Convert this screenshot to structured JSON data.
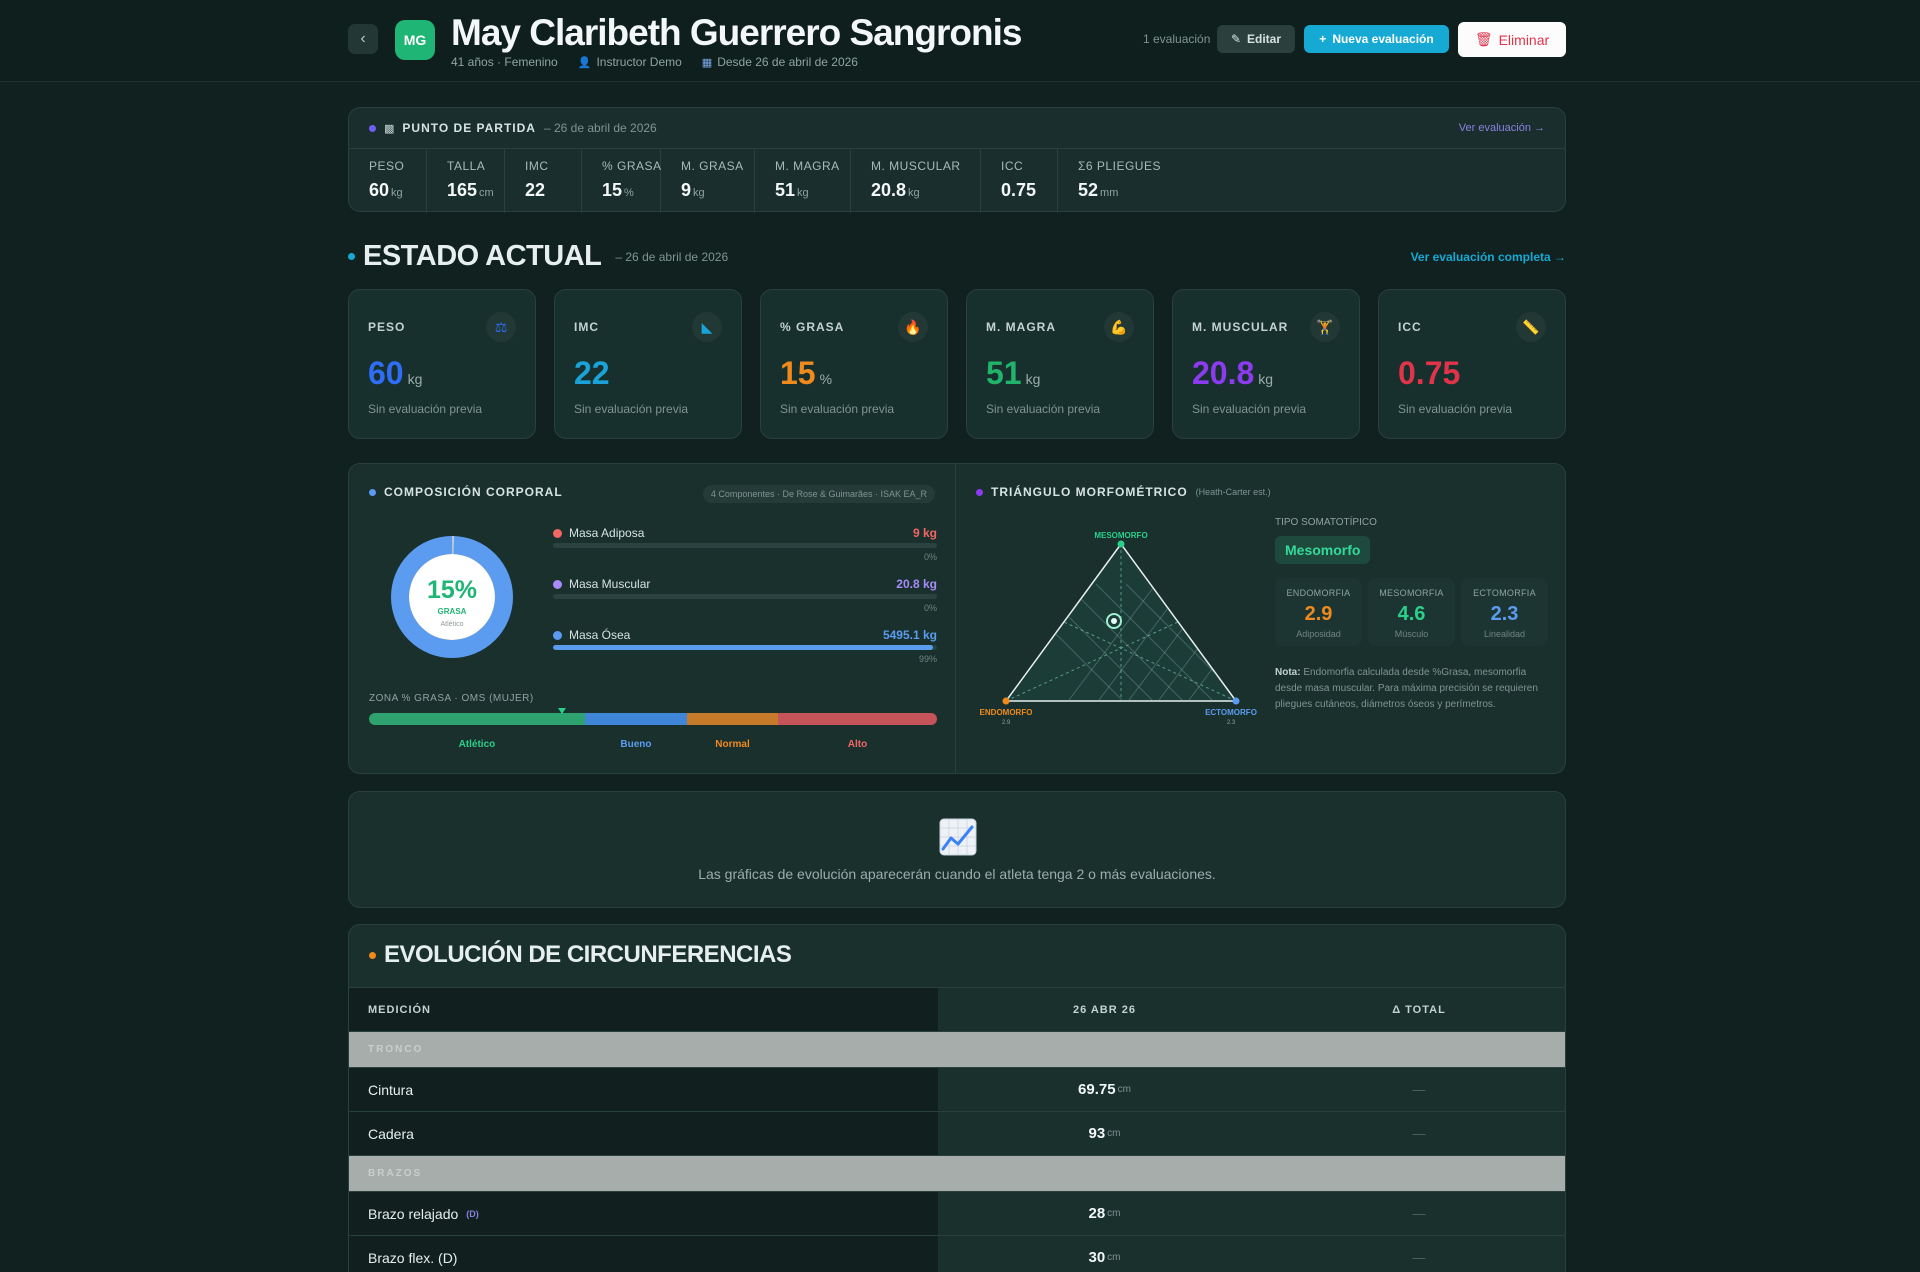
{
  "header": {
    "back_icon": "chevron-left-icon",
    "avatar_initials": "MG",
    "name": "May Claribeth Guerrero Sangronis",
    "meta_age_gender": "41 años · Femenino",
    "meta_instructor": "Instructor Demo",
    "meta_since": "Desde 26 de abril de 2026",
    "eval_count": "1 evaluación",
    "edit_label": "Editar",
    "new_eval_label": "Nueva evaluación",
    "delete_label": "Eliminar",
    "colors": {
      "avatar": "#1fb574",
      "primary": "#16a9d3",
      "danger": "#e0344a"
    }
  },
  "start": {
    "title": "PUNTO DE PARTIDA",
    "date": "– 26 de abril de 2026",
    "link": "Ver evaluación →",
    "metrics": [
      {
        "label": "PESO",
        "value": "60",
        "unit": "kg"
      },
      {
        "label": "TALLA",
        "value": "165",
        "unit": "cm"
      },
      {
        "label": "IMC",
        "value": "22",
        "unit": ""
      },
      {
        "label": "% GRASA",
        "value": "15",
        "unit": "%"
      },
      {
        "label": "M. GRASA",
        "value": "9",
        "unit": "kg"
      },
      {
        "label": "M. MAGRA",
        "value": "51",
        "unit": "kg"
      },
      {
        "label": "M. MUSCULAR",
        "value": "20.8",
        "unit": "kg"
      },
      {
        "label": "ICC",
        "value": "0.75",
        "unit": ""
      },
      {
        "label": "Σ6 PLIEGUES",
        "value": "52",
        "unit": "mm"
      }
    ]
  },
  "current": {
    "title": "ESTADO ACTUAL",
    "date": "– 26 de abril de 2026",
    "link": "Ver evaluación completa →",
    "kpis": [
      {
        "label": "PESO",
        "icon": "scale-icon",
        "glyph": "⚖",
        "value": "60",
        "unit": "kg",
        "sub": "Sin evaluación previa",
        "color": "#2f6df6"
      },
      {
        "label": "IMC",
        "icon": "ruler-triangle-icon",
        "glyph": "◣",
        "value": "22",
        "unit": "",
        "sub": "Sin evaluación previa",
        "color": "#1aa3d8"
      },
      {
        "label": "% GRASA",
        "icon": "flame-icon",
        "glyph": "🔥",
        "value": "15",
        "unit": "%",
        "sub": "Sin evaluación previa",
        "color": "#f08a1c"
      },
      {
        "label": "M. MAGRA",
        "icon": "flexed-arm-icon",
        "glyph": "💪",
        "value": "51",
        "unit": "kg",
        "sub": "Sin evaluación previa",
        "color": "#22b36b"
      },
      {
        "label": "M. MUSCULAR",
        "icon": "weightlifter-icon",
        "glyph": "🏋",
        "value": "20.8",
        "unit": "kg",
        "sub": "Sin evaluación previa",
        "color": "#8c3bf0"
      },
      {
        "label": "ICC",
        "icon": "tape-measure-icon",
        "glyph": "📏",
        "value": "0.75",
        "unit": "",
        "sub": "Sin evaluación previa",
        "color": "#e0344a"
      }
    ]
  },
  "composition": {
    "title": "COMPOSICIÓN CORPORAL",
    "tag": "4 Componentes · De Rose & Guimarães · ISAK EA_R",
    "donut_value": "15%",
    "donut_label": "GRASA",
    "donut_sub": "Atlético",
    "donut_fraction": 0.15,
    "items": [
      {
        "name": "Masa Adiposa",
        "value": "9 kg",
        "pct": "0%",
        "fill": 0.0,
        "color": "#f26666"
      },
      {
        "name": "Masa Muscular",
        "value": "20.8 kg",
        "pct": "0%",
        "fill": 0.0,
        "color": "#a78bfa"
      },
      {
        "name": "Masa Ósea",
        "value": "5495.1 kg",
        "pct": "99%",
        "fill": 0.99,
        "color": "#5b9cf0"
      }
    ],
    "zone_title": "ZONA % GRASA · OMS (MUJER)",
    "zone_marker": 0.34,
    "zones": [
      {
        "name": "Atlético",
        "span": 0.38,
        "color": "#2ea36f",
        "label_color": "#29d08a"
      },
      {
        "name": "Bueno",
        "span": 0.18,
        "color": "#3f86d8",
        "label_color": "#5b9cf0"
      },
      {
        "name": "Normal",
        "span": 0.16,
        "color": "#c77a2a",
        "label_color": "#f08a1c"
      },
      {
        "name": "Alto",
        "span": 0.28,
        "color": "#c55357",
        "label_color": "#f26666"
      }
    ]
  },
  "triangle": {
    "title": "TRIÁNGULO MORFOMÉTRICO",
    "subtitle": "(Heath-Carter est.)",
    "top_label": "MESOMORFO",
    "left_label": "ENDOMORFO",
    "left_value": "2.9",
    "right_label": "ECTOMORFO",
    "right_value": "2.3",
    "somatotype_label": "TIPO SOMATOTÍPICO",
    "somatotype": "Mesomorfo",
    "components": [
      {
        "label": "ENDOMORFIA",
        "value": "2.9",
        "sub": "Adiposidad",
        "color": "#f08a1c"
      },
      {
        "label": "MESOMORFIA",
        "value": "4.6",
        "sub": "Músculo",
        "color": "#29d08a"
      },
      {
        "label": "ECTOMORFIA",
        "value": "2.3",
        "sub": "Linealidad",
        "color": "#5b9cf0"
      }
    ],
    "note_bold": "Nota:",
    "note": "Endomorfia calculada desde %Grasa, mesomorfia desde masa muscular. Para máxima precisión se requieren pliegues cutáneos, diámetros óseos y perímetros."
  },
  "evolution": {
    "icon": "chart-up-icon",
    "message": "Las gráficas de evolución aparecerán cuando el atleta tenga 2 o más evaluaciones."
  },
  "circumferences": {
    "title": "EVOLUCIÓN DE CIRCUNFERENCIAS",
    "columns": [
      "MEDICIÓN",
      "26 ABR 26",
      "Δ TOTAL"
    ],
    "groups": [
      {
        "name": "TRONCO",
        "rows": [
          {
            "name": "Cintura",
            "side": "",
            "value": "69.75",
            "unit": "cm",
            "delta": "—"
          },
          {
            "name": "Cadera",
            "side": "",
            "value": "93",
            "unit": "cm",
            "delta": "—"
          }
        ]
      },
      {
        "name": "BRAZOS",
        "rows": [
          {
            "name": "Brazo relajado",
            "side": "(D)",
            "value": "28",
            "unit": "cm",
            "delta": "—"
          },
          {
            "name": "Brazo flex. (D)",
            "side": "",
            "value": "30",
            "unit": "cm",
            "delta": "—"
          }
        ]
      }
    ]
  }
}
